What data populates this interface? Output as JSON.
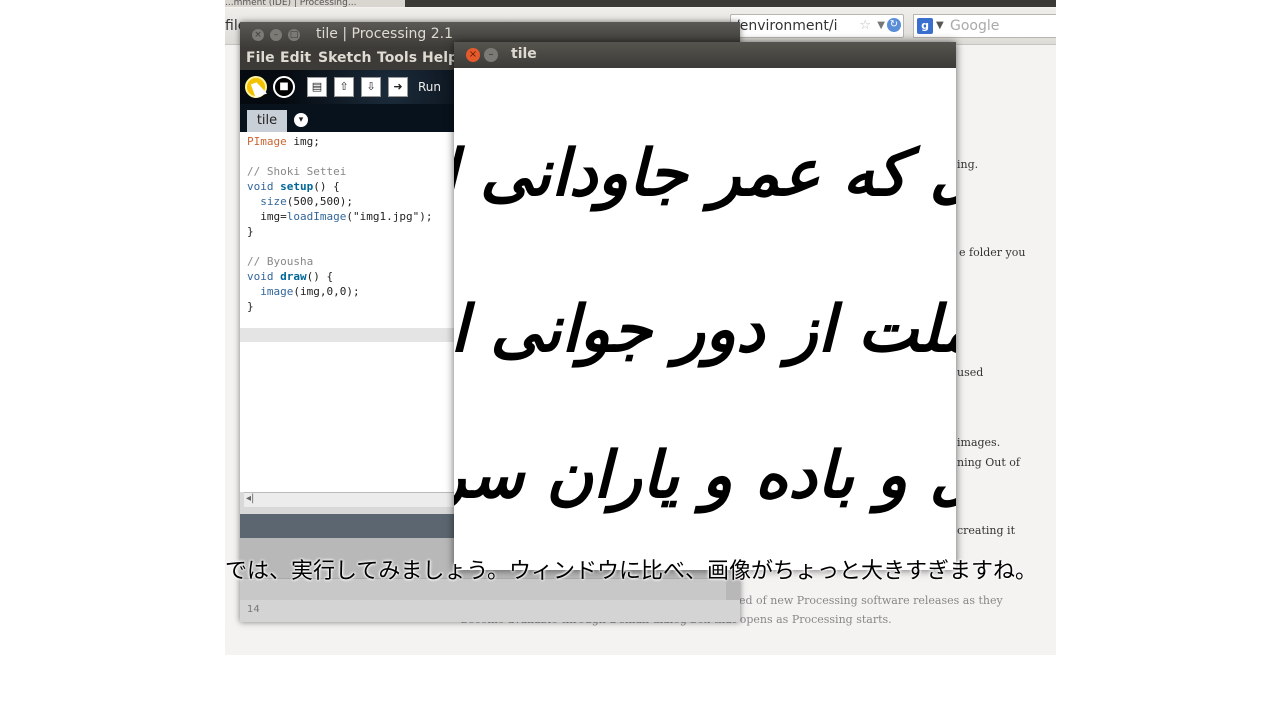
{
  "browser": {
    "tab_title": "...mment (IDE) | Processing...",
    "menu_file": "file",
    "url_text": "/environment/i",
    "search_placeholder": "Google",
    "search_engine_glyph": "g",
    "page_fragments": [
      "ing.",
      "e folder you",
      "used",
      "images.",
      "ning Out of",
      "creating it",
      "ed of new Processing software releases as they",
      "become available through a small dialog box that opens as Processing starts."
    ]
  },
  "pde": {
    "title": "tile | Processing 2.1",
    "menus": [
      "File",
      "Edit",
      "Sketch",
      "Tools",
      "Help"
    ],
    "toolbar": {
      "stop_glyph": "■",
      "new_glyph": "▤",
      "open_glyph": "⇧",
      "save_glyph": "⇩",
      "export_glyph": "➜",
      "run_label": "Run"
    },
    "tab_label": "tile",
    "tab_menu_glyph": "▾",
    "code": {
      "l1_type": "PImage",
      "l1_rest": " img;",
      "l2": "// Shoki Settei",
      "l3_kw": "void",
      "l3_fn": "setup",
      "l3_rest": "() {",
      "l4_fn": "size",
      "l4_rest": "(500,500);",
      "l5_a": "img=",
      "l5_fn": "loadImage",
      "l5_str": "(\"img1.jpg\")",
      "l5_end": ";",
      "l6": "}",
      "l7": "// Byousha",
      "l8_kw": "void",
      "l8_fn": "draw",
      "l8_rest": "() {",
      "l9_fn": "image",
      "l9_rest": "(img,0,0);",
      "l10": "}"
    },
    "hscroll_glyph": "◂|",
    "line_number": "14"
  },
  "sketch": {
    "title": "tile",
    "close_glyph": "×",
    "min_glyph": "–",
    "calligraphy_lines": [
      "ل که عمر جاودانی اینست",
      "ملت از دور جوانی اینست",
      "ل و باده و یاران سرمست"
    ]
  },
  "subtitle": "では、実行してみましょう。ウィンドウに比べ、画像がちょっと大きすぎますね。"
}
